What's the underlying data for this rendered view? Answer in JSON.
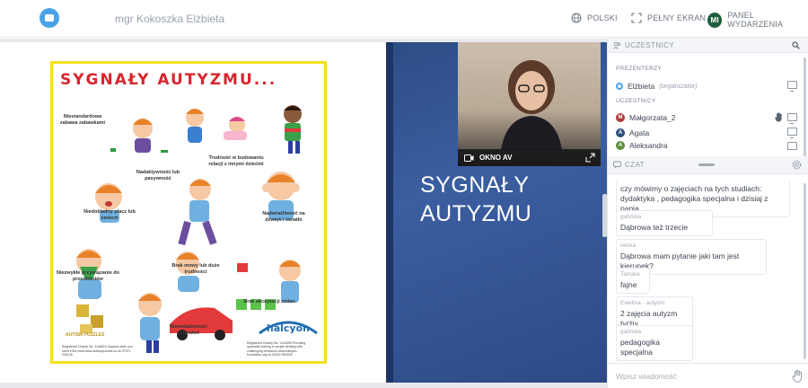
{
  "topbar": {
    "presenter_name": "mgr Kokoszka Elżbieta",
    "language_label": "POLSKI",
    "fullscreen_label": "PEŁNY EKRAN",
    "avatar_initials": "MI",
    "event_panel_label": "PANEL WYDARZENIA"
  },
  "poster": {
    "title": "SYGNAŁY AUTYZMU...",
    "labels": [
      "Niestandardowa zabawa zabawkami",
      "Trudność w budowaniu relacji z innymi dziećmi",
      "Nadaktywność lub pasywność",
      "Niedokładny płacz lub śmiech",
      "Nadwrażliwość na dźwięk i światło",
      "Niezwykłe przywiązanie do przedmiotów",
      "Brak mowy lub duże trudności",
      "Brak akceptacji zmian",
      "Nieświadomość zagrożeń"
    ],
    "logo_left": "AUTISM PUZZLES",
    "logo_right": "halcyon",
    "charity_left": "Registered Charity No: 1148010 Support when you need it the most www.autismpuzzles.co.uk 07971 040126",
    "charity_right": "Registered Charity No: 1141655 Providing specialist training to people dealing with challenging behaviour www.halcyon-foundation.org.uk 02920 553918"
  },
  "slide": {
    "title_line1": "SYGNAŁY",
    "title_line2": "AUTYZMU"
  },
  "video": {
    "label": "OKNO AV"
  },
  "participants": {
    "header": "UCZESTNICY",
    "presenters_label": "PREZENTERZY",
    "participants_label": "UCZESTNICY",
    "presenter": {
      "name": "Elżbieta",
      "role": "(organizator)"
    },
    "users": [
      {
        "initial": "M",
        "name": "Małgorzata_2",
        "color": "#b03a3a"
      },
      {
        "initial": "A",
        "name": "Agata",
        "color": "#2c4f7c"
      },
      {
        "initial": "A",
        "name": "Aleksandra",
        "color": "#5a8f3a"
      }
    ]
  },
  "chat": {
    "header": "CZAT",
    "messages": [
      {
        "author": "",
        "text": "czy mówimy o zajęciach na tych studiach: dydaktyka , pedagogika specjalna i dzisiaj z panią"
      },
      {
        "author": "gabriela",
        "text": "Dąbrowa też trzecie"
      },
      {
        "author": "iwona",
        "text": "Dąbrowa mam pytanie jaki tam jest kierunek?"
      },
      {
        "author": "Tamara",
        "text": "fajne"
      },
      {
        "author": "Ewelina - autyzm",
        "text": "2 zajęcia autyzm tychy"
      },
      {
        "author": "gabriela",
        "text": "pedagogika specjalna"
      }
    ],
    "input_placeholder": "Wpisz wiadomość"
  },
  "colors": {
    "accent": "#4aa3e8",
    "slide_bg": "#2e4d86",
    "poster_border": "#f2e21c",
    "poster_title": "#d8262e"
  }
}
